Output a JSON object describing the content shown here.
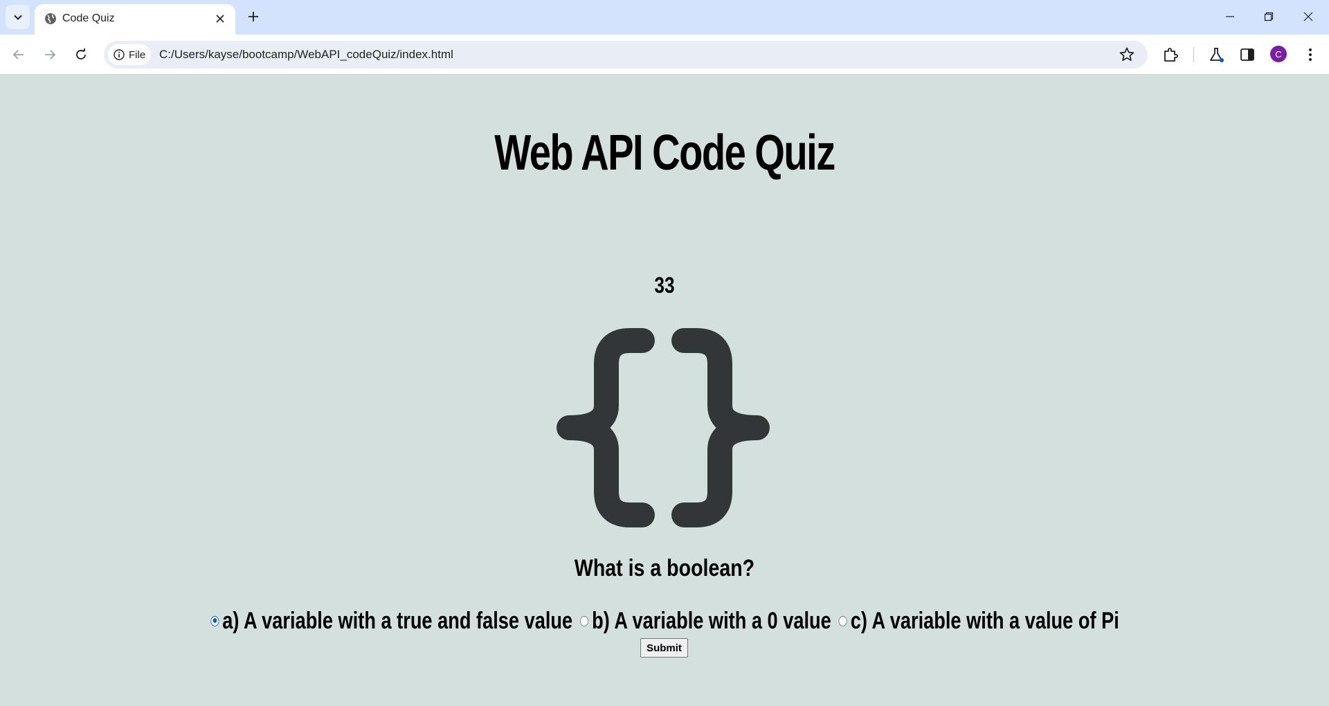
{
  "browser": {
    "tab_title": "Code Quiz",
    "site_info_label": "File",
    "url": "C:/Users/kayse/bootcamp/WebAPI_codeQuiz/index.html",
    "profile_initial": "C"
  },
  "page": {
    "title": "Web API Code Quiz",
    "timer": "33",
    "logo_icon": "curly-braces-icon",
    "question": "What is a boolean?",
    "answers": [
      {
        "label": "a) A variable with a true and false value",
        "selected": true
      },
      {
        "label": "b) A variable with a 0 value",
        "selected": false
      },
      {
        "label": "c) A variable with a value of Pi",
        "selected": false
      }
    ],
    "submit_label": "Submit"
  },
  "colors": {
    "page_background": "#d4e0de",
    "brace_color": "#333638",
    "tabstrip": "#d3e3fd",
    "avatar": "#7b1fa2",
    "radio_accent": "#0b57d0"
  }
}
